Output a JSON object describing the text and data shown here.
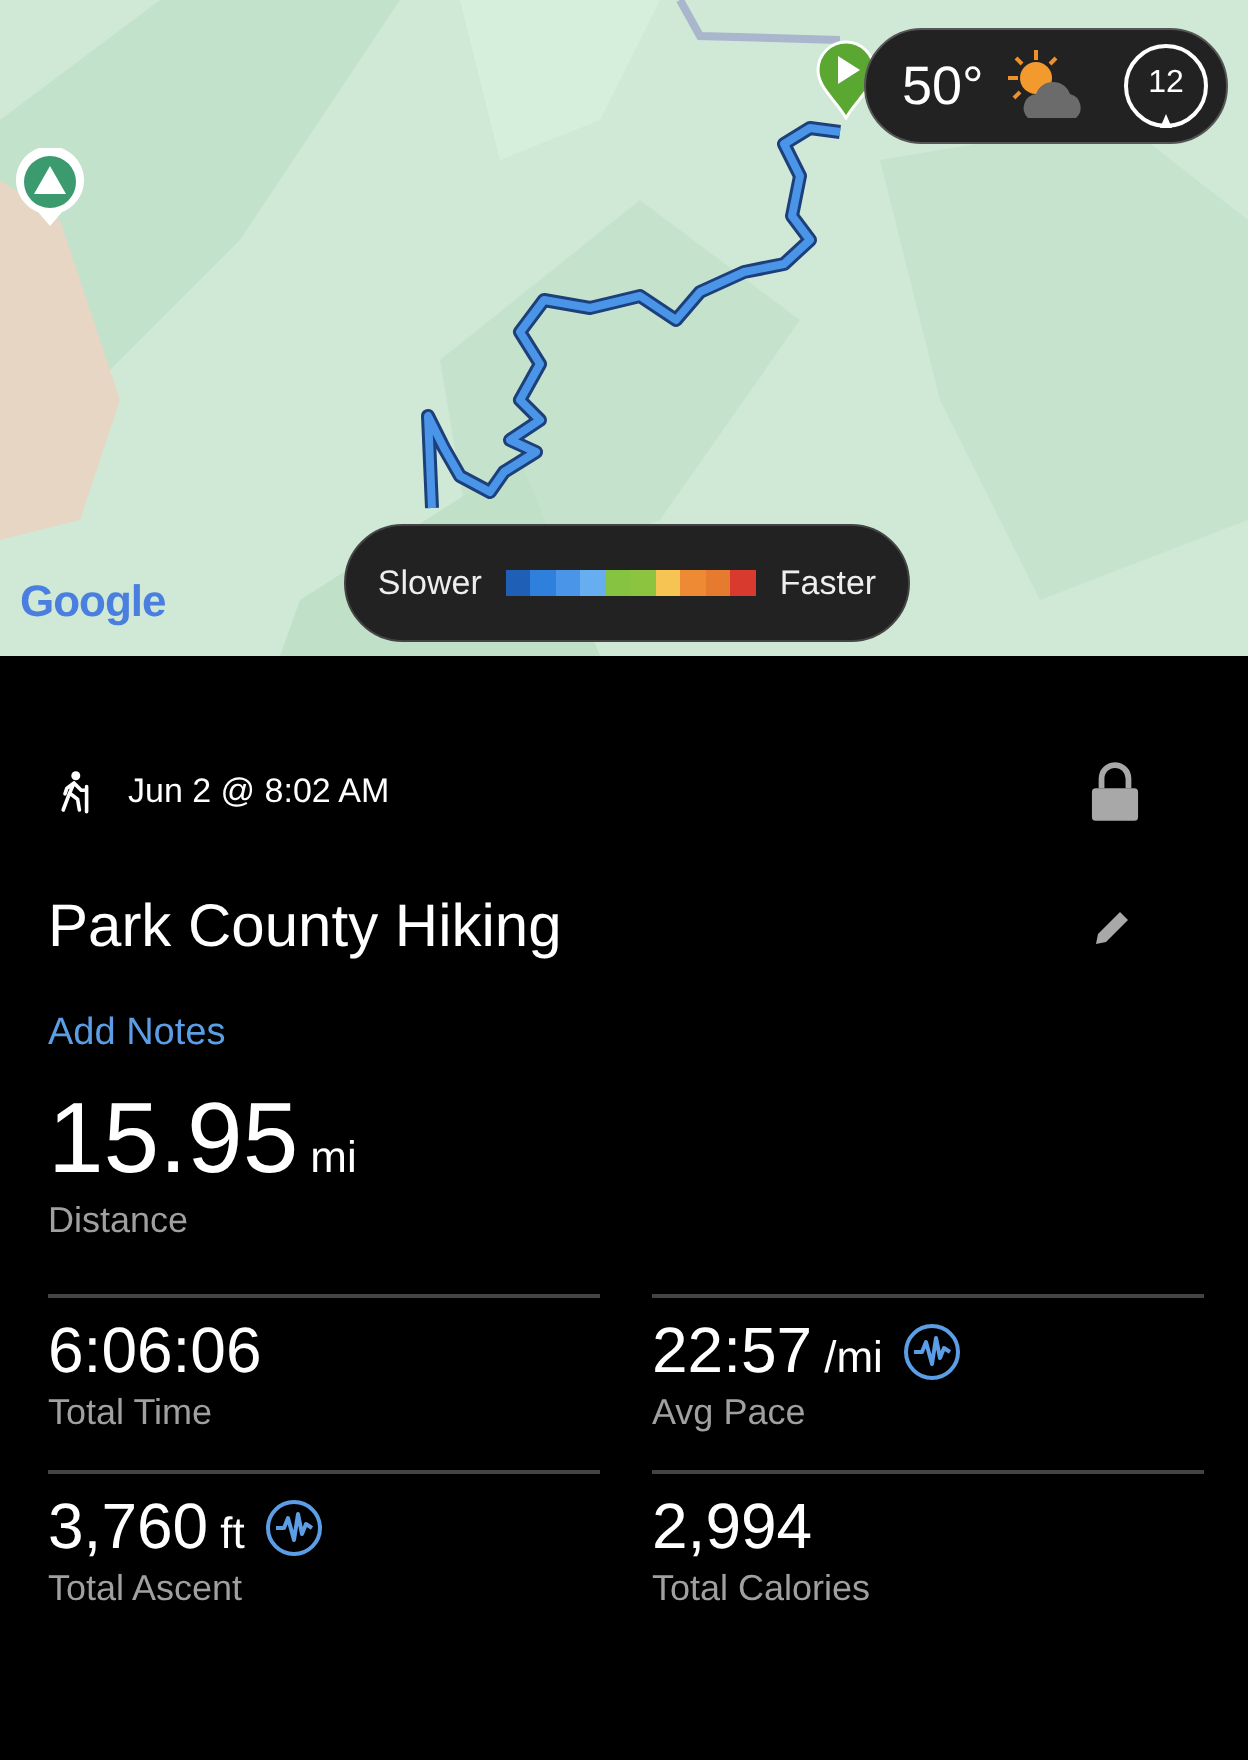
{
  "map": {
    "attribution": "Google",
    "weather": {
      "temperature": "50°",
      "compass": "12"
    },
    "legend": {
      "slower": "Slower",
      "faster": "Faster",
      "segments": [
        {
          "color": "#1f5fb5"
        },
        {
          "color": "#2f7fdc"
        },
        {
          "color": "#4a95e8"
        },
        {
          "color": "#66aef0"
        },
        {
          "color": "#86c341"
        },
        {
          "color": "#8cc440"
        },
        {
          "color": "#f6c453"
        },
        {
          "color": "#ef8a34"
        },
        {
          "color": "#e67a2e"
        },
        {
          "color": "#d93a2e"
        }
      ]
    }
  },
  "activity": {
    "date": "Jun 2 @ 8:02 AM",
    "locked": true,
    "title": "Park County Hiking",
    "notes_link": "Add Notes"
  },
  "distance": {
    "value": "15.95",
    "unit": "mi",
    "label": "Distance"
  },
  "stats": [
    {
      "value": "6:06:06",
      "label": "Total Time",
      "chart": false
    },
    {
      "value": "22:57",
      "unit": "/mi",
      "label": "Avg Pace",
      "chart": true
    },
    {
      "value": "3,760",
      "unit": "ft",
      "label": "Total Ascent",
      "chart": true
    },
    {
      "value": "2,994",
      "label": "Total Calories",
      "chart": false
    }
  ]
}
